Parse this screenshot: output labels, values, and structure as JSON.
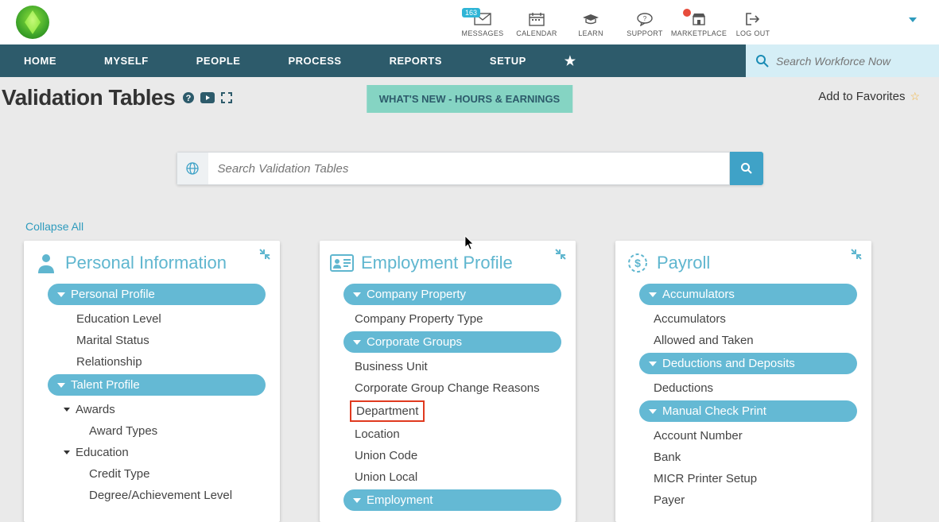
{
  "topbar": {
    "messages": {
      "label": "MESSAGES",
      "badge": "163"
    },
    "calendar": {
      "label": "CALENDAR"
    },
    "learn": {
      "label": "LEARN"
    },
    "support": {
      "label": "SUPPORT"
    },
    "marketplace": {
      "label": "MARKETPLACE"
    },
    "logout": {
      "label": "LOG OUT"
    }
  },
  "nav": {
    "home": "HOME",
    "myself": "MYSELF",
    "people": "PEOPLE",
    "process": "PROCESS",
    "reports": "REPORTS",
    "setup": "SETUP",
    "search_placeholder": "Search Workforce Now"
  },
  "page": {
    "title": "Validation Tables",
    "whatsnew": "WHAT'S NEW - HOURS & EARNINGS",
    "favorites": "Add to Favorites",
    "search_placeholder": "Search Validation Tables",
    "collapse_all": "Collapse All"
  },
  "cards": {
    "personal": {
      "title": "Personal Information",
      "groups": {
        "personal_profile": {
          "label": "Personal Profile",
          "items": [
            "Education Level",
            "Marital Status",
            "Relationship"
          ]
        },
        "talent_profile": {
          "label": "Talent Profile",
          "subgroups": {
            "awards": {
              "label": "Awards",
              "items": [
                "Award Types"
              ]
            },
            "education": {
              "label": "Education",
              "items": [
                "Credit Type",
                "Degree/Achievement Level"
              ]
            }
          }
        }
      }
    },
    "employment": {
      "title": "Employment Profile",
      "groups": {
        "company_property": {
          "label": "Company Property",
          "items": [
            "Company Property Type"
          ]
        },
        "corporate_groups": {
          "label": "Corporate Groups",
          "items": [
            "Business Unit",
            "Corporate Group Change Reasons",
            "Department",
            "Location",
            "Union Code",
            "Union Local"
          ]
        },
        "employment": {
          "label": "Employment"
        }
      }
    },
    "payroll": {
      "title": "Payroll",
      "groups": {
        "accumulators": {
          "label": "Accumulators",
          "items": [
            "Accumulators",
            "Allowed and Taken"
          ]
        },
        "deductions": {
          "label": "Deductions and Deposits",
          "items": [
            "Deductions"
          ]
        },
        "manual_check": {
          "label": "Manual Check Print",
          "items": [
            "Account Number",
            "Bank",
            "MICR Printer Setup",
            "Payer"
          ]
        }
      }
    }
  }
}
